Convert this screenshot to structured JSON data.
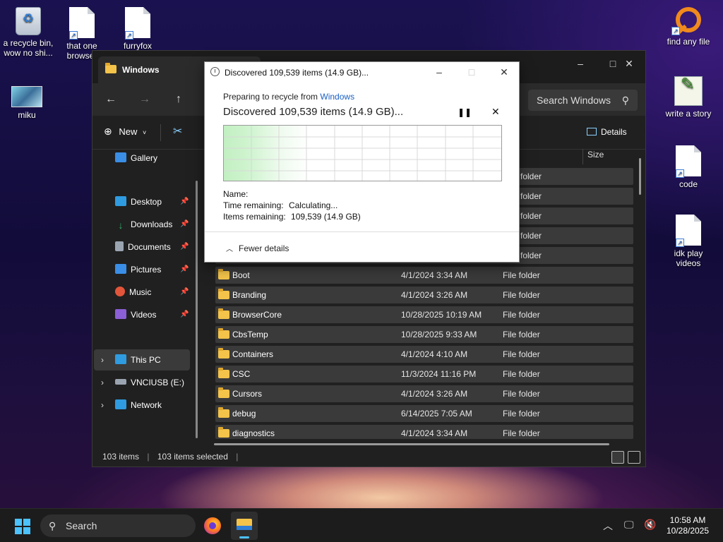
{
  "desktop": {
    "icons": [
      {
        "label": "a recycle bin, wow no shi...",
        "kind": "recycle-bin"
      },
      {
        "label": "that one browser",
        "kind": "file-shortcut"
      },
      {
        "label": "furryfox",
        "kind": "file-shortcut"
      },
      {
        "label": "miku",
        "kind": "image"
      },
      {
        "label": "find any file",
        "kind": "app-shortcut"
      },
      {
        "label": "write a story",
        "kind": "app-shortcut"
      },
      {
        "label": "code",
        "kind": "file-shortcut"
      },
      {
        "label": "idk play videos",
        "kind": "file-shortcut"
      }
    ]
  },
  "explorer": {
    "tab_title": "Windows",
    "window_controls": {
      "minimize": "–",
      "maximize": "□",
      "close": "✕"
    },
    "search_placeholder": "Search Windows",
    "toolbar": {
      "new_label": "New",
      "details_label": "Details"
    },
    "sidebar": {
      "gallery": "Gallery",
      "quick_access": [
        {
          "label": "Desktop",
          "icon": "desktop-icon",
          "color": "#2f9be0"
        },
        {
          "label": "Downloads",
          "icon": "download-icon",
          "color": "#2fb36b"
        },
        {
          "label": "Documents",
          "icon": "document-icon",
          "color": "#9aa4b1"
        },
        {
          "label": "Pictures",
          "icon": "pictures-icon",
          "color": "#3a8ee6"
        },
        {
          "label": "Music",
          "icon": "music-icon",
          "color": "#e2553a"
        },
        {
          "label": "Videos",
          "icon": "videos-icon",
          "color": "#8b5fd6"
        }
      ],
      "this_pc": "This PC",
      "drive": "VNCIUSB (E:)",
      "network": "Network"
    },
    "columns": {
      "size": "Size"
    },
    "hidden_row_type": "folder",
    "rows": [
      {
        "name": "Boot",
        "date": "4/1/2024 3:34 AM",
        "type": "File folder"
      },
      {
        "name": "Branding",
        "date": "4/1/2024 3:26 AM",
        "type": "File folder"
      },
      {
        "name": "BrowserCore",
        "date": "10/28/2025 10:19 AM",
        "type": "File folder"
      },
      {
        "name": "CbsTemp",
        "date": "10/28/2025 9:33 AM",
        "type": "File folder"
      },
      {
        "name": "Containers",
        "date": "4/1/2024 4:10 AM",
        "type": "File folder"
      },
      {
        "name": "CSC",
        "date": "11/3/2024 11:16 PM",
        "type": "File folder"
      },
      {
        "name": "Cursors",
        "date": "4/1/2024 3:26 AM",
        "type": "File folder"
      },
      {
        "name": "debug",
        "date": "6/14/2025 7:05 AM",
        "type": "File folder"
      },
      {
        "name": "diagnostics",
        "date": "4/1/2024 3:34 AM",
        "type": "File folder"
      }
    ],
    "status": {
      "items": "103 items",
      "selected": "103 items selected"
    }
  },
  "dialog": {
    "title": "Discovered 109,539 items (14.9 GB)...",
    "preparing_prefix": "Preparing to recycle from ",
    "preparing_link": "Windows",
    "heading": "Discovered 109,539 items (14.9 GB)...",
    "name_label": "Name:",
    "time_remaining_label": "Time remaining:",
    "time_remaining_value": "Calculating...",
    "items_remaining_label": "Items remaining:",
    "items_remaining_value": "109,539 (14.9 GB)",
    "fewer_details": "Fewer details",
    "graph_accent": "#7bd67b"
  },
  "taskbar": {
    "search_placeholder": "Search",
    "time": "10:58 AM",
    "date": "10/28/2025",
    "accent": "#4cc2ff"
  }
}
